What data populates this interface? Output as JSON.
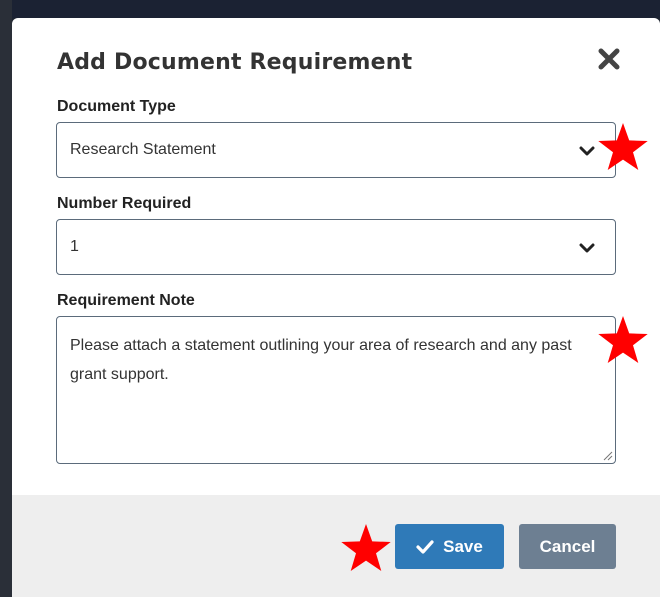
{
  "dialog": {
    "title": "Add Document Requirement",
    "close_icon": "close-icon"
  },
  "fields": {
    "document_type": {
      "label": "Document Type",
      "value": "Research Statement"
    },
    "number_required": {
      "label": "Number Required",
      "value": "1"
    },
    "requirement_note": {
      "label": "Requirement Note",
      "value": "Please attach a statement outlining your area of research and any past grant support."
    }
  },
  "footer": {
    "save_label": "Save",
    "cancel_label": "Cancel"
  },
  "annotations": {
    "marker_icon": "star-icon",
    "marker_color": "#ff0000"
  },
  "colors": {
    "primary": "#2f7ab8",
    "secondary": "#6d7f92",
    "footer_bg": "#eeeeee"
  }
}
